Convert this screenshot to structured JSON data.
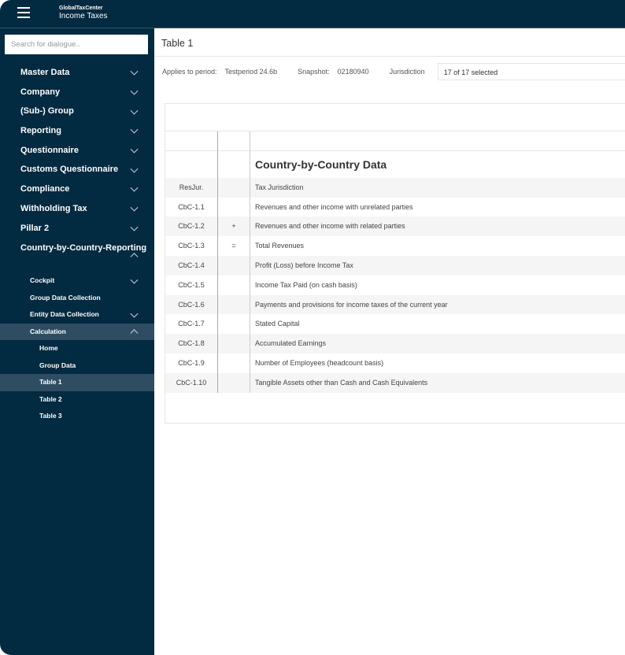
{
  "header": {
    "brand_small": "GlobalTaxCenter",
    "title": "Income Taxes"
  },
  "sidebar": {
    "search_placeholder": "Search for dialogue..",
    "items": [
      {
        "label": "Master Data"
      },
      {
        "label": "Company"
      },
      {
        "label": "(Sub-) Group"
      },
      {
        "label": "Reporting"
      },
      {
        "label": "Questionnaire"
      },
      {
        "label": "Customs Questionnaire"
      },
      {
        "label": "Compliance"
      },
      {
        "label": "Withholding Tax"
      },
      {
        "label": "Pillar 2"
      },
      {
        "label": "Country-by-Country-Reporting"
      }
    ],
    "cbcr_items": [
      {
        "label": "Cockpit"
      },
      {
        "label": "Group Data Collection"
      },
      {
        "label": "Entity Data Collection"
      },
      {
        "label": "Calculation"
      }
    ],
    "calc_items": [
      {
        "label": "Home"
      },
      {
        "label": "Group Data"
      },
      {
        "label": "Table 1"
      },
      {
        "label": "Table 2"
      },
      {
        "label": "Table 3"
      }
    ]
  },
  "page": {
    "title": "Table 1",
    "period_label": "Applies to period:",
    "period_value": "Testperiod 24.6b",
    "snapshot_label": "Snapshot:",
    "snapshot_value": "02180940",
    "jurisdiction_label": "Jurisdiction",
    "jurisdiction_value": "17 of 17 selected"
  },
  "table": {
    "section_title": "Country-by-Country Data",
    "rows": [
      {
        "code": "ResJur.",
        "op": "",
        "label": "Tax Jurisdiction"
      },
      {
        "code": "CbC-1.1",
        "op": "",
        "label": "Revenues and other income with unrelated parties"
      },
      {
        "code": "CbC-1.2",
        "op": "+",
        "label": "Revenues and other income with related parties"
      },
      {
        "code": "CbC-1.3",
        "op": "=",
        "label": "Total Revenues"
      },
      {
        "code": "CbC-1.4",
        "op": "",
        "label": "Profit (Loss) before Income Tax"
      },
      {
        "code": "CbC-1.5",
        "op": "",
        "label": "Income Tax Paid (on cash basis)"
      },
      {
        "code": "CbC-1.6",
        "op": "",
        "label": "Payments and provisions for income taxes of the current year"
      },
      {
        "code": "CbC-1.7",
        "op": "",
        "label": "Stated Capital"
      },
      {
        "code": "CbC-1.8",
        "op": "",
        "label": "Accumulated Earnings"
      },
      {
        "code": "CbC-1.9",
        "op": "",
        "label": "Number of Employees (headcount basis)"
      },
      {
        "code": "CbC-1.10",
        "op": "",
        "label": "Tangible Assets other than Cash and Cash Equivalents"
      }
    ]
  }
}
